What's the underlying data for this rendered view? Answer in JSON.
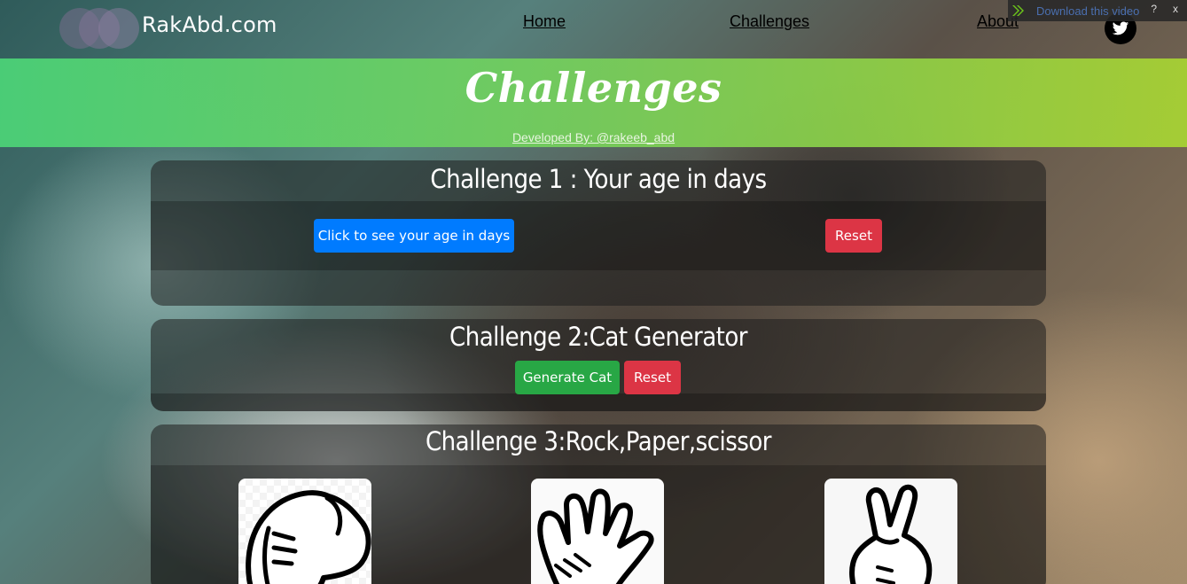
{
  "nav": {
    "logo_text": "RakAbd.com",
    "links": [
      "Home",
      "Challenges",
      "About"
    ],
    "social_icon": "twitter-icon"
  },
  "download_bar": {
    "label": "Download this video",
    "help": "?",
    "close": "x"
  },
  "banner": {
    "title": "Challenges",
    "subtitle": "Developed By: @rakeeb_abd"
  },
  "challenges": [
    {
      "title": "Challenge 1 : Your age in days",
      "primary_button": "Click to see your age in days",
      "reset_button": "Reset"
    },
    {
      "title": "Challenge 2:Cat Generator",
      "primary_button": "Generate Cat",
      "reset_button": "Reset"
    },
    {
      "title": "Challenge 3:Rock,Paper,scissor",
      "choices": [
        "rock",
        "paper",
        "scissor"
      ]
    }
  ],
  "colors": {
    "primary_blue": "#007bff",
    "danger_red": "#dc3545",
    "success_green": "#28a745",
    "banner_start": "#4cd478",
    "banner_end": "#aad732"
  }
}
